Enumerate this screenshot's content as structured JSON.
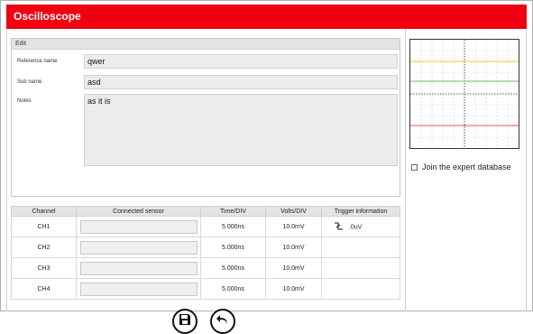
{
  "app": {
    "title": "Oscilloscope"
  },
  "edit": {
    "header": "Edit",
    "reference_label": "Reference name",
    "reference_value": "qwer",
    "subname_label": "Sub name",
    "subname_value": "asd",
    "notes_label": "Notes",
    "notes_value": "as it is"
  },
  "table": {
    "headers": [
      "Channel",
      "Connected sensor",
      "Time/DIV",
      "Volts/DIV",
      "Trigger information"
    ],
    "rows": [
      {
        "channel": "CH1",
        "time": "5.000ns",
        "volts": "10.0mV",
        "trigger": ".0uV"
      },
      {
        "channel": "CH2",
        "time": "5.000ns",
        "volts": "10.0mV",
        "trigger": ""
      },
      {
        "channel": "CH3",
        "time": "5.000ns",
        "volts": "10.0mV",
        "trigger": ""
      },
      {
        "channel": "CH4",
        "time": "5.000ns",
        "volts": "10.0mV",
        "trigger": ""
      }
    ]
  },
  "sidebar": {
    "join_label": "Join the expert database",
    "join_checked": false
  },
  "icons": {
    "save": "save-icon",
    "back": "back-icon",
    "trigger": "falling-edge-trigger-icon"
  },
  "colors": {
    "titlebar": "#f00010",
    "trace1": "#f0c040",
    "trace2": "#60c060",
    "trace3": "#e06060"
  }
}
